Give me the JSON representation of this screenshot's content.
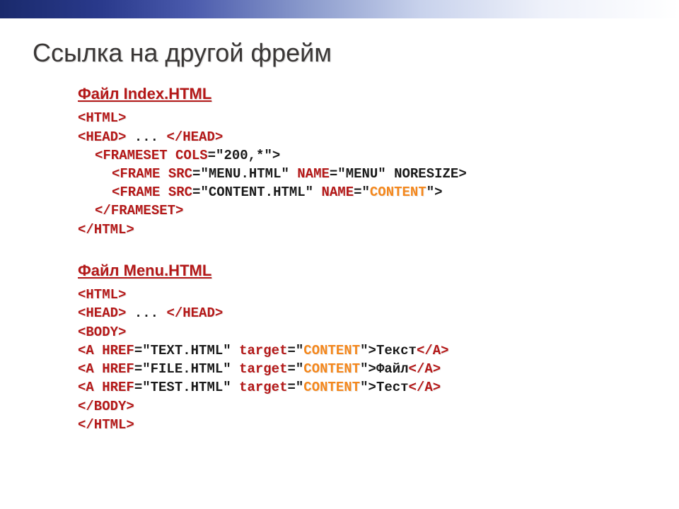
{
  "title": "Ссылка на другой фрейм",
  "file1": {
    "heading": "Файл Index.HTML",
    "l1": "<HTML>",
    "l2a": "<HEAD>",
    "l2b": " ... ",
    "l2c": "</HEAD>",
    "l3a": "<FRAMESET ",
    "l3b": "COLS",
    "l3c": "=\"200,*\">",
    "l4a": "<FRAME ",
    "l4b": "SRC",
    "l4c": "=\"MENU.HTML\" ",
    "l4d": "NAME",
    "l4e": "=\"MENU\" NORESIZE>",
    "l5a": "<FRAME ",
    "l5b": "SRC",
    "l5c": "=\"CONTENT.HTML\" ",
    "l5d": "NAME",
    "l5e": "=\"",
    "l5f": "CONTENT",
    "l5g": "\">",
    "l6": "</FRAMESET>",
    "l7": "</HTML>"
  },
  "file2": {
    "heading": "Файл Menu.HTML",
    "l1": "<HTML>",
    "l2a": "<HEAD>",
    "l2b": " ... ",
    "l2c": "</HEAD>",
    "l3": "<BODY>",
    "l4a": "<A ",
    "l4b": "HREF",
    "l4c": "=\"TEXT.HTML\" ",
    "l4d": "target",
    "l4e": "=\"",
    "l4f": "CONTENT",
    "l4g": "\">",
    "l4h": "Текст",
    "l4i": "</A>",
    "l5a": "<A ",
    "l5b": "HREF",
    "l5c": "=\"FILE.HTML\" ",
    "l5d": "target",
    "l5e": "=\"",
    "l5f": "CONTENT",
    "l5g": "\">",
    "l5h": "Файл",
    "l5i": "</A>",
    "l6a": "<A ",
    "l6b": "HREF",
    "l6c": "=\"TEST.HTML\" ",
    "l6d": "target",
    "l6e": "=\"",
    "l6f": "CONTENT",
    "l6g": "\">",
    "l6h": "Тест",
    "l6i": "</A>",
    "l7": "</BODY>",
    "l8": "</HTML>"
  }
}
